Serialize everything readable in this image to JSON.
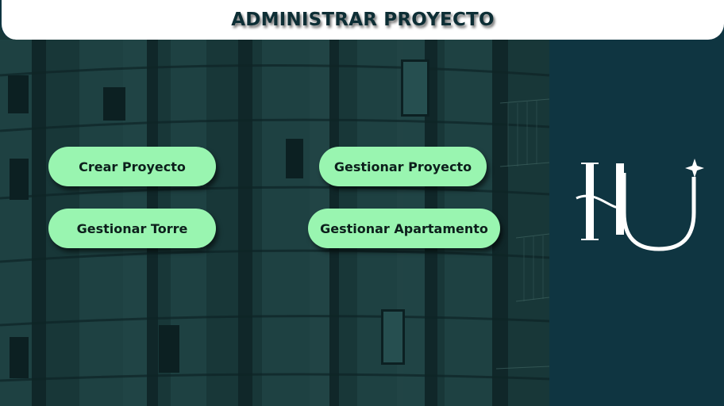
{
  "header": {
    "title": "ADMINISTRAR PROYECTO"
  },
  "actions": [
    {
      "id": "crear-proyecto",
      "label": "Crear Proyecto"
    },
    {
      "id": "gestionar-proyecto",
      "label": "Gestionar Proyecto"
    },
    {
      "id": "gestionar-torre",
      "label": "Gestionar Torre"
    },
    {
      "id": "gestionar-apartamento",
      "label": "Gestionar Apartamento"
    }
  ],
  "logo": {
    "icon": "hu-monogram-logo",
    "letters": "HU"
  },
  "colors": {
    "header_bg": "#ffffff",
    "header_text": "#0d2e35",
    "button_bg": "#99f5b0",
    "button_text": "#0d1f1c",
    "panel_bg": "#0f3541",
    "photo_tint": "#1b3a3b"
  }
}
